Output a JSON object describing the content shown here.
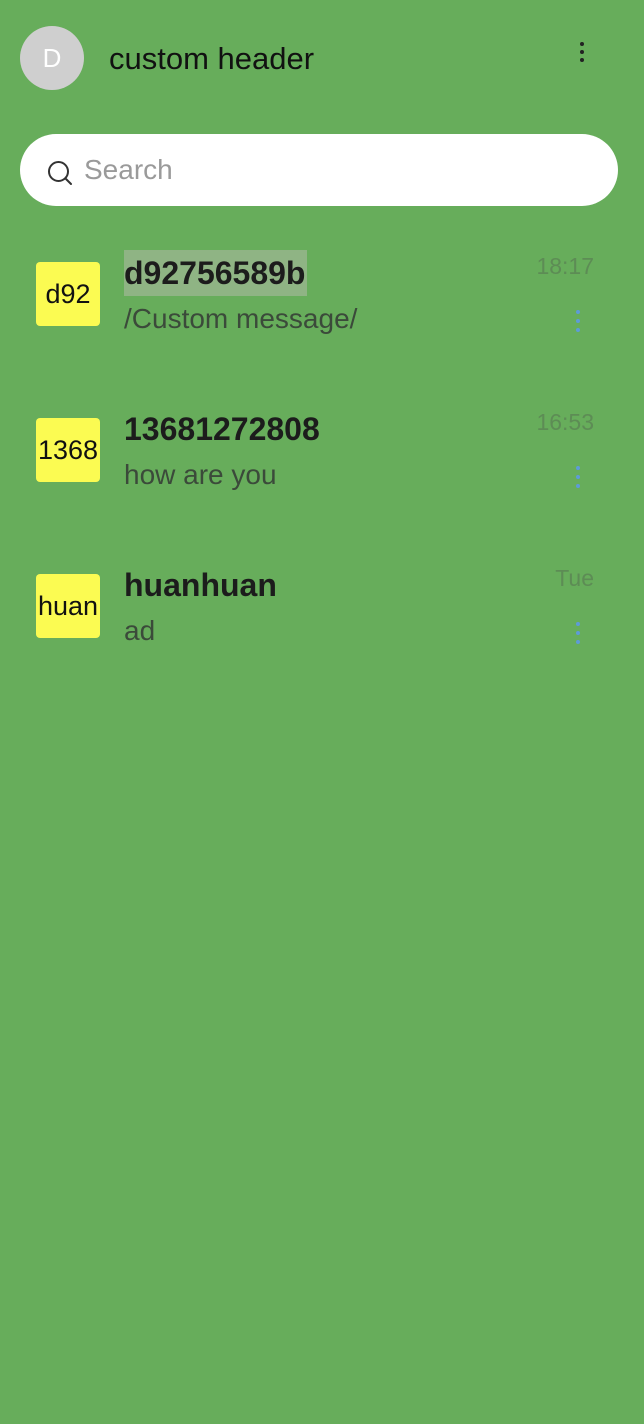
{
  "header": {
    "avatar_letter": "D",
    "title": "custom header",
    "more_icon": "more-vertical-icon"
  },
  "search": {
    "placeholder": "Search",
    "value": "",
    "icon": "search-icon"
  },
  "conversations": [
    {
      "avatar_text": "d92",
      "name": "d92756589b",
      "last_message": "/Custom message/",
      "time": "18:17",
      "selected": true
    },
    {
      "avatar_text": "1368",
      "name": "13681272808",
      "last_message": "how are you",
      "time": "16:53",
      "selected": false
    },
    {
      "avatar_text": "huan",
      "name": "huanhuan",
      "last_message": "ad",
      "time": "Tue",
      "selected": false
    }
  ],
  "colors": {
    "background": "#67ad5b",
    "avatar_yellow": "#fbfb52",
    "more_dots_blue": "#5e9bd8"
  }
}
